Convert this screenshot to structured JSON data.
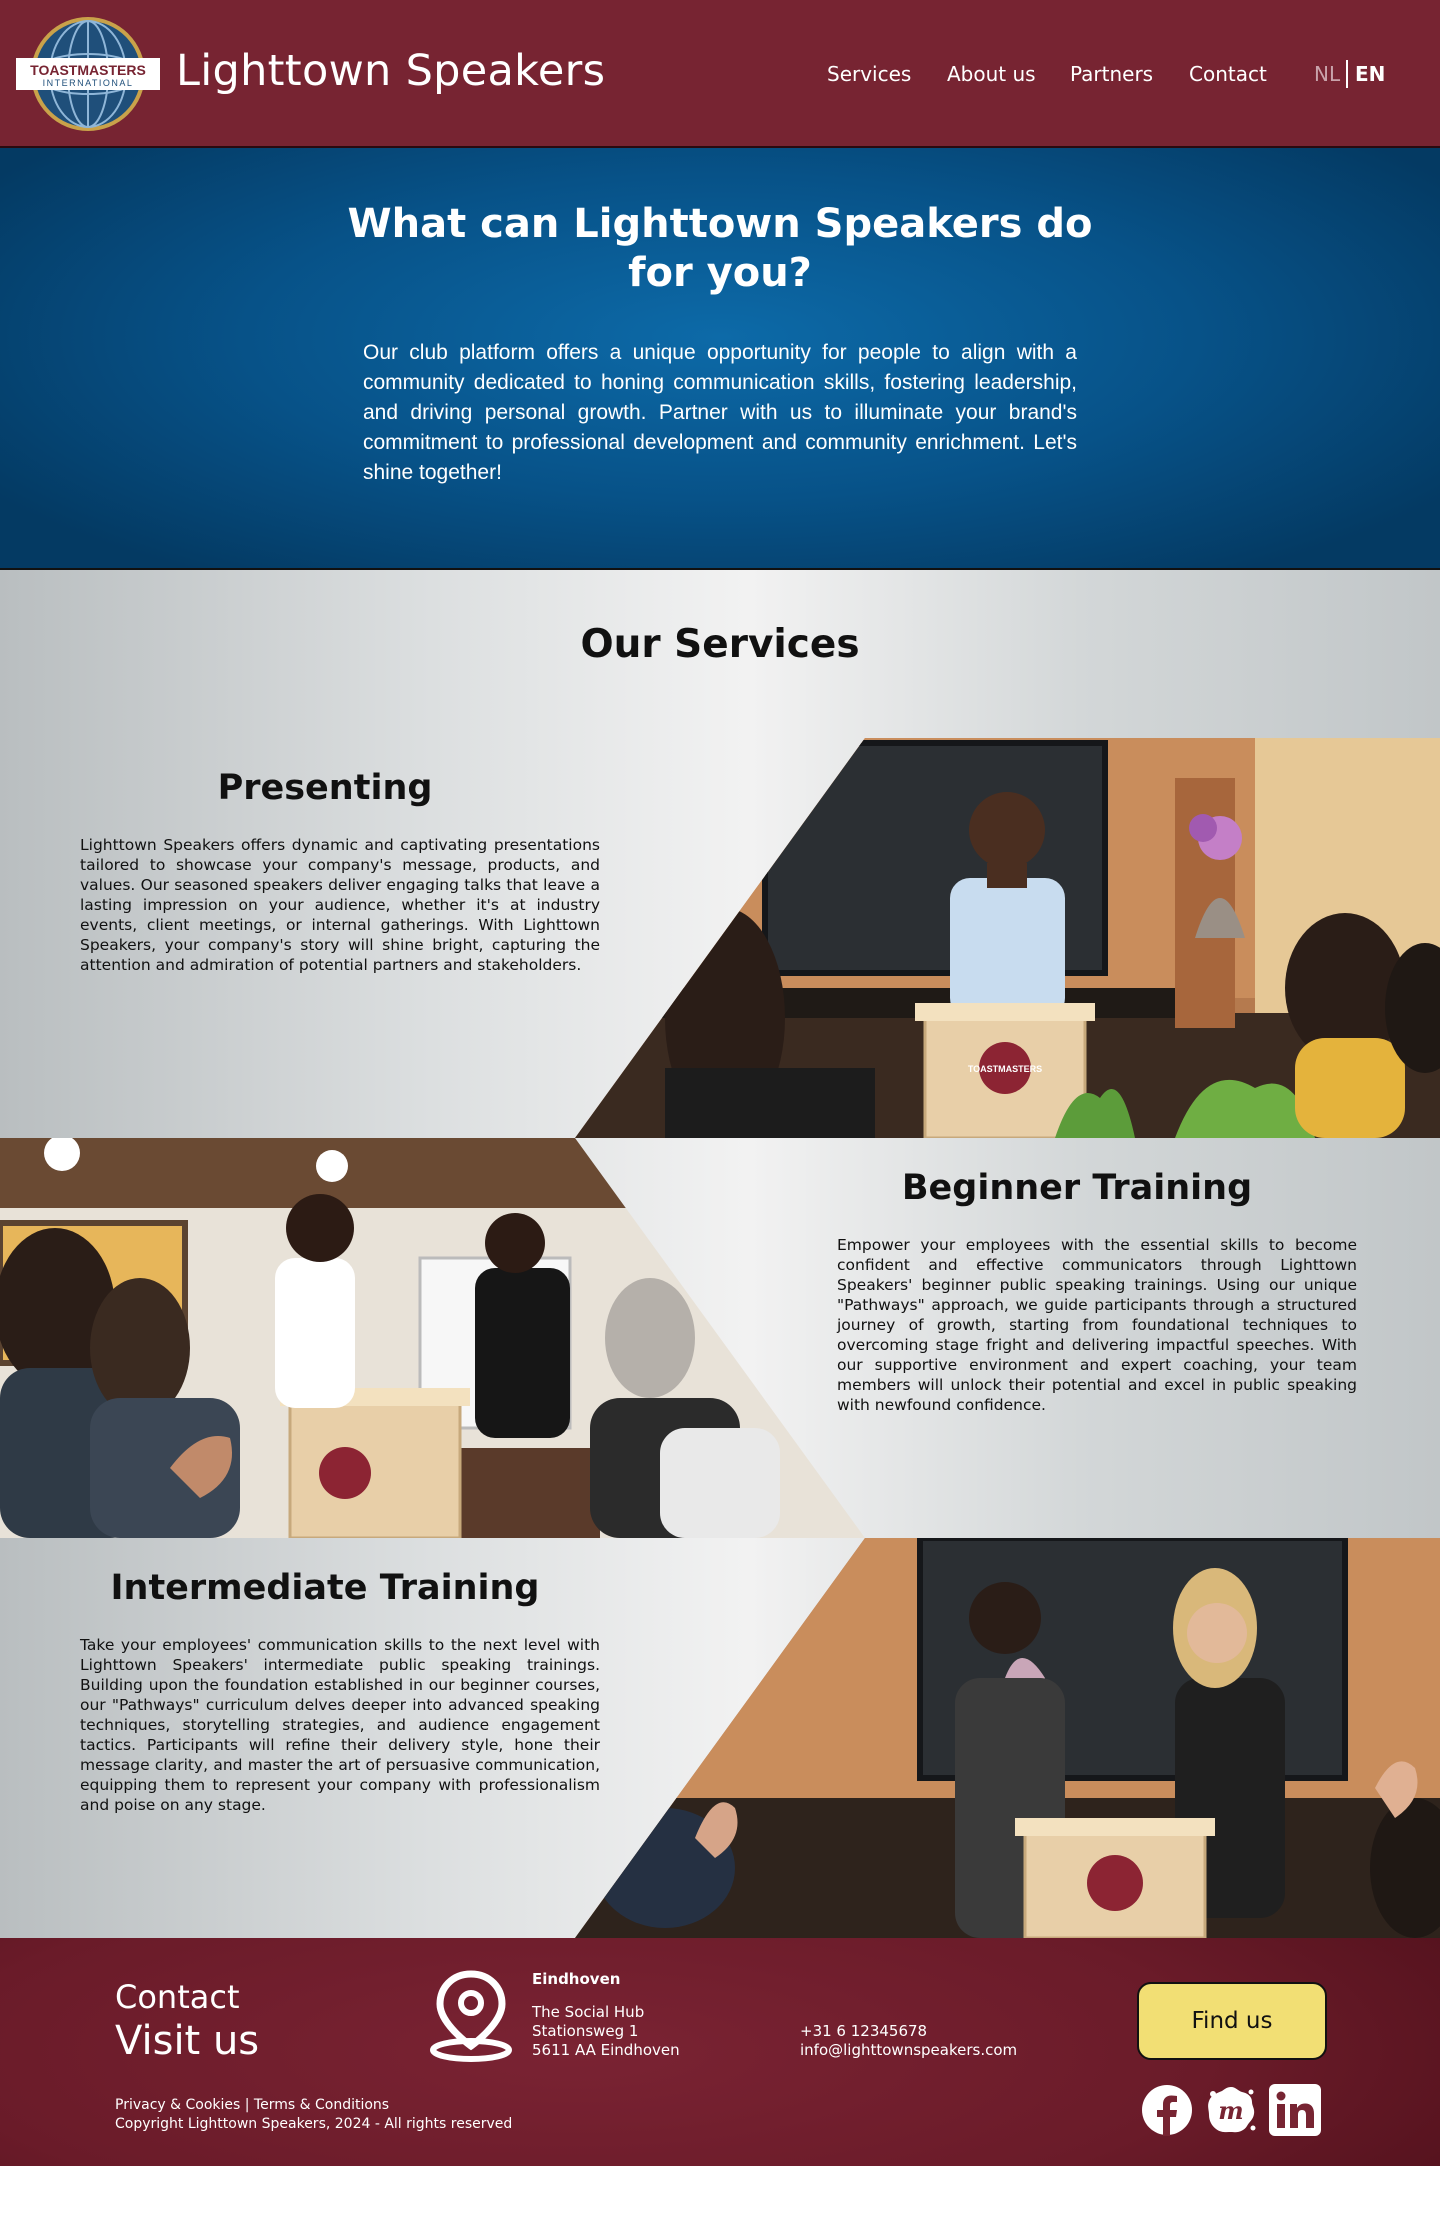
{
  "header": {
    "logo_text_top": "TOASTMASTERS",
    "logo_text_bottom": "INTERNATIONAL",
    "site_title": "Lighttown Speakers",
    "nav": [
      "Services",
      "About us",
      "Partners",
      "Contact"
    ],
    "lang_nl": "NL",
    "lang_en": "EN",
    "lang_active": "EN"
  },
  "hero": {
    "title": "What can Lighttown Speakers do for you?",
    "text": "Our club platform offers a unique opportunity for people to align with a community dedicated to honing communication skills, fostering leadership, and driving personal growth. Partner with us to illuminate your brand's commitment to professional development and community enrichment. Let's shine together!"
  },
  "services": {
    "title": "Our Services",
    "items": [
      {
        "title": "Presenting",
        "text": "Lighttown Speakers offers dynamic and captivating presentations tailored to showcase your company's message, products, and values. Our seasoned speakers deliver engaging talks that leave a lasting impression on your audience, whether it's at industry events, client meetings, or internal gatherings. With Lighttown Speakers, your company's story will shine bright, capturing the attention and admiration of potential partners and stakeholders."
      },
      {
        "title": "Beginner Training",
        "text": "Empower your employees with the essential skills to become confident and effective communicators through Lighttown Speakers' beginner public speaking trainings. Using our unique \"Pathways\" approach, we guide participants through a structured journey of growth, starting from foundational techniques to overcoming stage fright and delivering impactful speeches. With our supportive environment and expert coaching, your team members will unlock their potential and excel in public speaking with newfound confidence."
      },
      {
        "title": "Intermediate Training",
        "text": "Take your employees' communication skills to the next level with Lighttown Speakers' intermediate public speaking trainings. Building upon the foundation established in our beginner courses, our \"Pathways\" curriculum delves deeper into advanced speaking techniques, storytelling strategies, and audience engagement tactics. Participants will refine their delivery style, hone their message clarity, and master the art of persuasive communication, equipping them to represent your company with professionalism and poise on any stage."
      }
    ],
    "lectern_label": "TOASTMASTERS"
  },
  "footer": {
    "contact": "Contact",
    "visit": "Visit us",
    "city": "Eindhoven",
    "address": [
      "The Social Hub",
      "Stationsweg 1",
      "5611 AA Eindhoven"
    ],
    "phone": "+31 6 12345678",
    "email": "info@lighttownspeakers.com",
    "find_us": "Find us",
    "legal": "Privacy & Cookies | Terms & Conditions",
    "copyright": "Copyright Lighttown Speakers, 2024 - All rights reserved",
    "social": [
      "facebook-icon",
      "meetup-icon",
      "linkedin-icon"
    ]
  },
  "colors": {
    "brand_maroon": "#772432",
    "hero_blue": "#075288",
    "button_yellow": "#f2df74"
  }
}
